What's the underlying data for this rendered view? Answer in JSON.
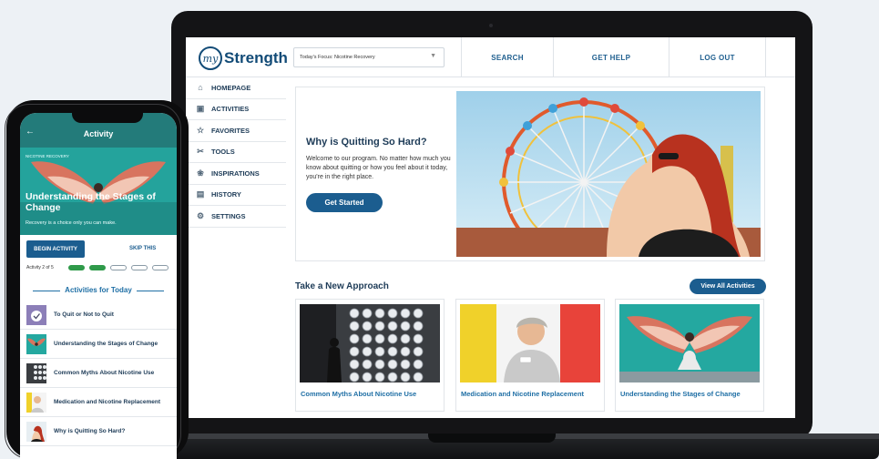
{
  "laptop": {
    "logo": {
      "my": "my",
      "strength": "Strength"
    },
    "focus_select": {
      "value": "Today's Focus: Nicotine Recovery"
    },
    "nav": {
      "search": "SEARCH",
      "get_help": "GET HELP",
      "log_out": "LOG OUT"
    },
    "sidebar": {
      "items": [
        {
          "label": "HOMEPAGE",
          "icon": "home-icon"
        },
        {
          "label": "ACTIVITIES",
          "icon": "activities-icon"
        },
        {
          "label": "FAVORITES",
          "icon": "star-icon"
        },
        {
          "label": "TOOLS",
          "icon": "tools-icon"
        },
        {
          "label": "INSPIRATIONS",
          "icon": "inspiration-icon"
        },
        {
          "label": "HISTORY",
          "icon": "history-icon"
        },
        {
          "label": "SETTINGS",
          "icon": "gear-icon"
        }
      ]
    },
    "hero": {
      "title": "Why is Quitting So Hard?",
      "body": "Welcome to our program. No matter how much you know about quitting or how you feel about it today, you're in the right place.",
      "button": "Get Started"
    },
    "section": {
      "title": "Take a New Approach",
      "view_all": "View All Activities"
    },
    "cards": [
      {
        "title": "Common Myths About Nicotine Use"
      },
      {
        "title": "Medication and Nicotine Replacement"
      },
      {
        "title": "Understanding the Stages of Change"
      }
    ]
  },
  "phone": {
    "header": {
      "title": "Activity"
    },
    "hero": {
      "tag": "NICOTINE RECOVERY",
      "title": "Understanding the Stages of Change",
      "subtitle": "Recovery is a choice only you can make."
    },
    "begin_button": "BEGIN ACTIVITY",
    "skip_button": "SKIP THIS",
    "progress": {
      "label": "Activity 2 of 5",
      "completed": 2,
      "total": 5
    },
    "section_title": "Activities for Today",
    "items": [
      {
        "title": "To Quit or Not to Quit"
      },
      {
        "title": "Understanding the Stages of Change"
      },
      {
        "title": "Common Myths About Nicotine Use"
      },
      {
        "title": "Medication and Nicotine Replacement"
      },
      {
        "title": "Why is Quitting So Hard?"
      }
    ]
  },
  "colors": {
    "brand_blue": "#1b5d8f",
    "link_blue": "#1f6fa5",
    "teal": "#237b7a",
    "progress_green": "#2f9a4a"
  }
}
